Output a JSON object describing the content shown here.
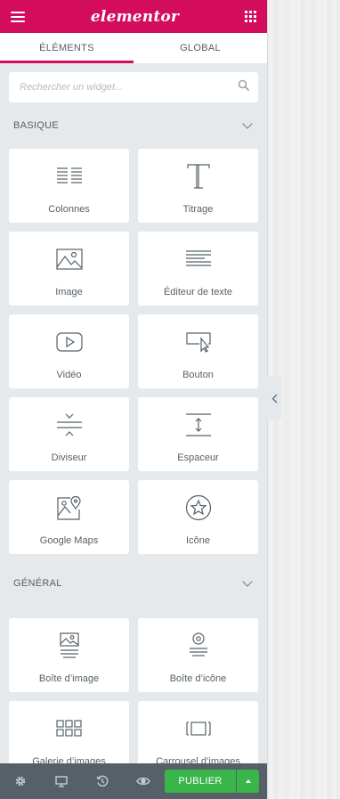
{
  "header": {
    "logo": "elementor"
  },
  "tabs": [
    {
      "label": "ÉLÉMENTS",
      "active": true
    },
    {
      "label": "GLOBAL",
      "active": false
    }
  ],
  "search": {
    "placeholder": "Rechercher un widget..."
  },
  "sections": {
    "basic": {
      "title": "BASIQUE"
    },
    "general": {
      "title": "GÉNÉRAL"
    }
  },
  "widgets": {
    "columns": "Colonnes",
    "heading": "Titrage",
    "image": "Image",
    "text_editor": "Éditeur de texte",
    "video": "Vidéo",
    "button": "Bouton",
    "divider": "Diviseur",
    "spacer": "Espaceur",
    "google_maps": "Google Maps",
    "icon": "Icône",
    "image_box": "Boîte d’image",
    "icon_box": "Boîte d’icône",
    "image_gallery": "Galerie d’images",
    "image_carousel": "Carrousel d’images"
  },
  "footer": {
    "publish_label": "PUBLIER"
  },
  "colors": {
    "brand": "#d30c5c",
    "panel_bg": "#e6e9ec",
    "footer_bg": "#556068",
    "publish_green": "#39b54a",
    "text": "#556068"
  }
}
